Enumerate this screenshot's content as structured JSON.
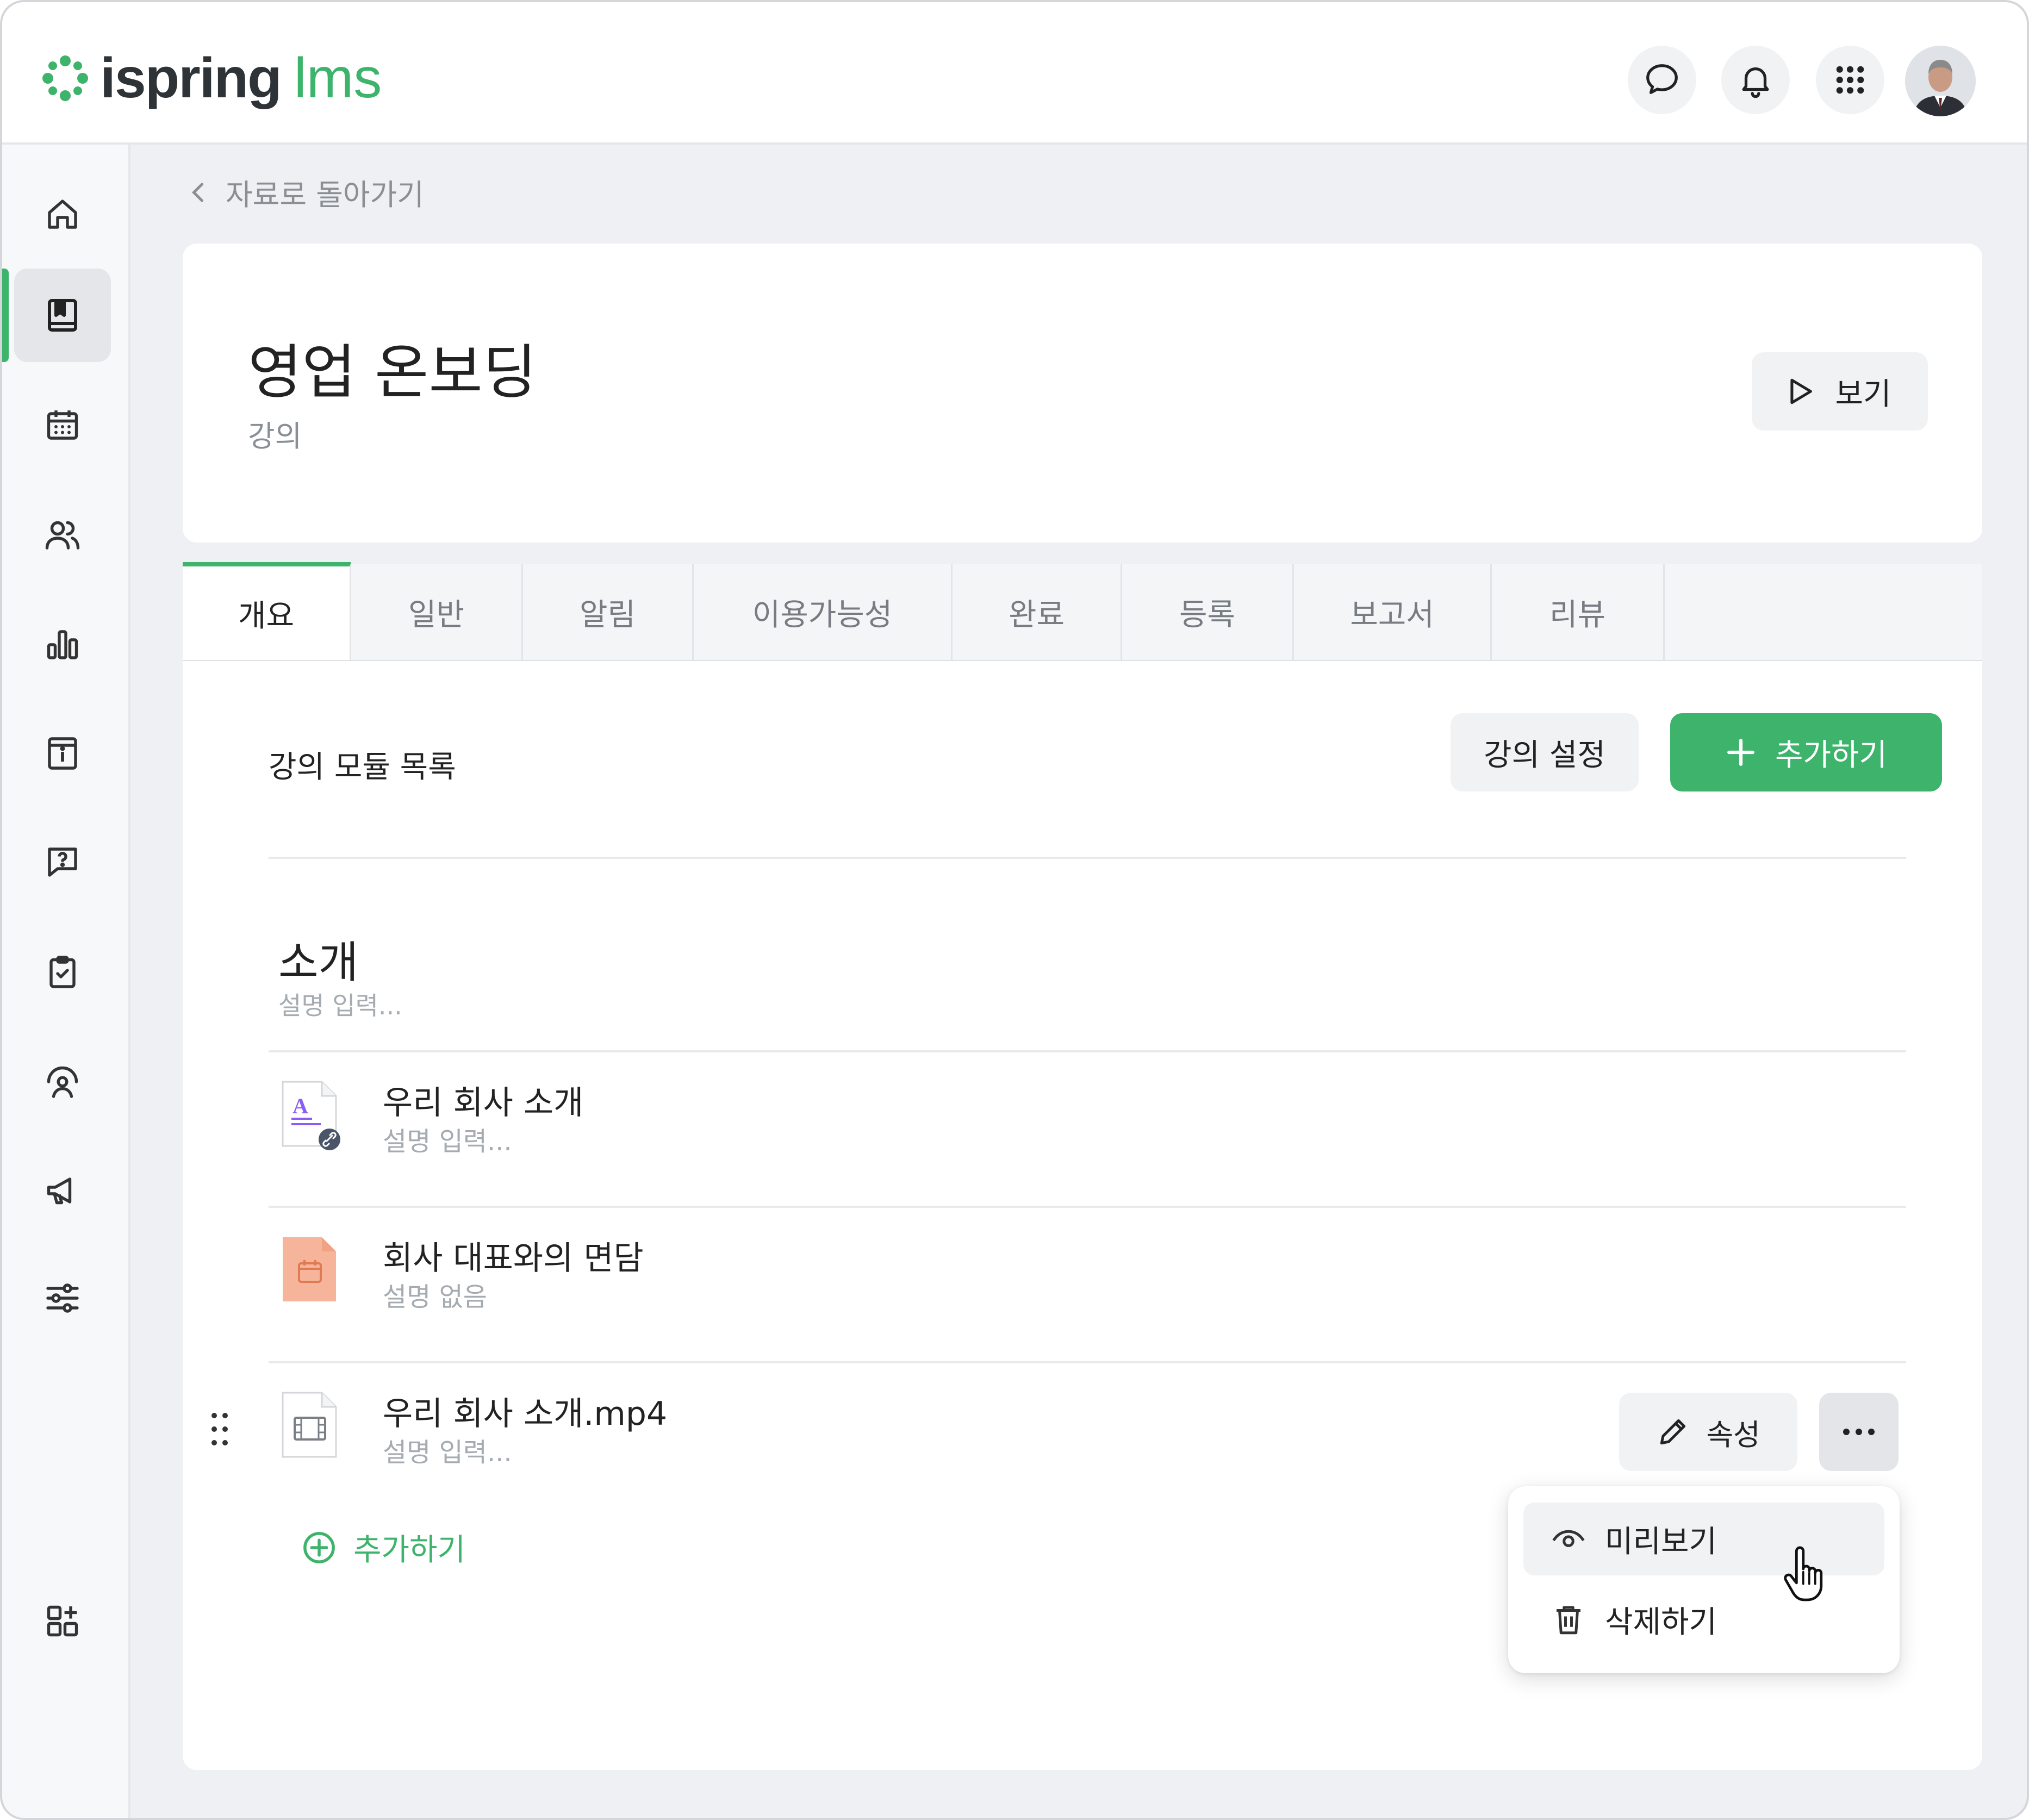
{
  "app": {
    "logo_main": "ispring",
    "logo_sub": "lms",
    "brand_color": "#3db36b"
  },
  "topbar": {
    "icons": [
      "chat-icon",
      "bell-icon",
      "apps-grid-icon",
      "user-avatar"
    ]
  },
  "sidebar": {
    "items": [
      {
        "icon": "home-icon"
      },
      {
        "icon": "book-icon",
        "active": true
      },
      {
        "icon": "calendar-icon"
      },
      {
        "icon": "users-icon"
      },
      {
        "icon": "chart-icon"
      },
      {
        "icon": "info-icon"
      },
      {
        "icon": "question-icon"
      },
      {
        "icon": "clipboard-check-icon"
      },
      {
        "icon": "gauge-user-icon"
      },
      {
        "icon": "megaphone-icon"
      },
      {
        "icon": "sliders-icon"
      }
    ],
    "bottom_icon": "add-widget-icon"
  },
  "breadcrumb": {
    "back_label": "자료로 돌아가기"
  },
  "course": {
    "title": "영업 온보딩",
    "type": "강의",
    "view_button": "보기"
  },
  "tabs": [
    "개요",
    "일반",
    "알림",
    "이용가능성",
    "완료",
    "등록",
    "보고서",
    "리뷰"
  ],
  "active_tab": "개요",
  "modules": {
    "list_title": "강의 모듈 목록",
    "settings_button": "강의 설정",
    "add_button": "추가하기",
    "section": {
      "title": "소개",
      "description": "설명 입력..."
    },
    "items": [
      {
        "name": "우리 회사 소개",
        "description": "설명 입력...",
        "icon": "document-link-icon"
      },
      {
        "name": "회사 대표와의 면담",
        "description": "설명 없음",
        "icon": "meeting-calendar-icon"
      },
      {
        "name": "우리 회사 소개.mp4",
        "description": "설명 입력...",
        "icon": "video-icon"
      }
    ],
    "properties_button": "속성",
    "add_link": "추가하기"
  },
  "context_menu": {
    "items": [
      {
        "label": "미리보기",
        "icon": "eye-icon"
      },
      {
        "label": "삭제하기",
        "icon": "trash-icon"
      }
    ]
  }
}
